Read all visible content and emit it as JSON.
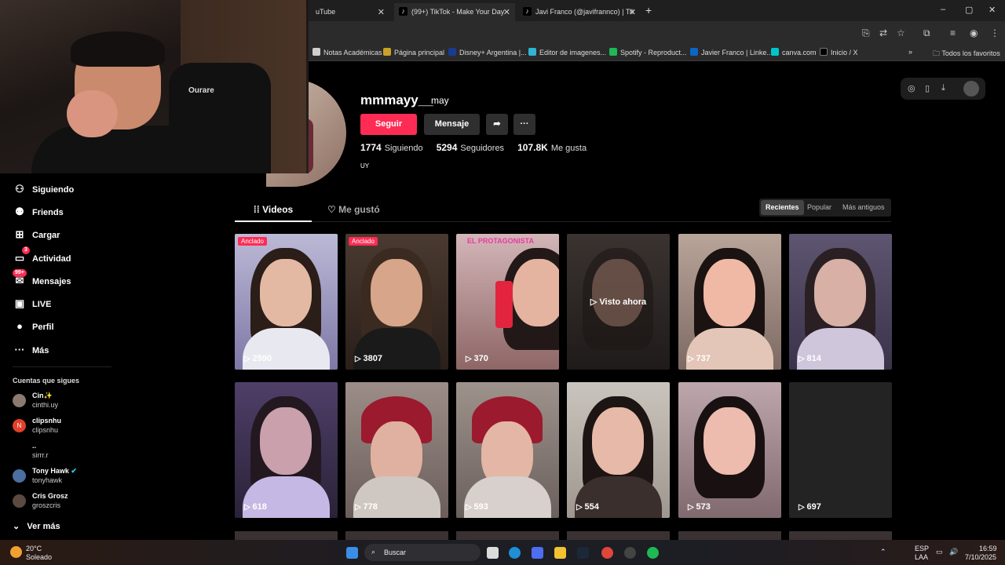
{
  "browser": {
    "tabs": [
      {
        "label": "uTube",
        "icon": "youtube-icon"
      },
      {
        "label": "(99+) TikTok - Make Your Day",
        "icon": "tiktok-icon"
      },
      {
        "label": "Javi Franco (@javifrannco) | Tik",
        "icon": "tiktok-icon"
      }
    ],
    "new_tab": "+",
    "window_controls": [
      "–",
      "▢",
      "✕"
    ],
    "bookmarks": [
      {
        "label": "Notas Académicas",
        "color": "#cfcfcf"
      },
      {
        "label": "Página principal",
        "color": "#c9a227"
      },
      {
        "label": "Disney+ Argentina |...",
        "color": "#1a3c8e"
      },
      {
        "label": "Editor de imagenes...",
        "color": "#31b3d4"
      },
      {
        "label": "Spotify - Reproduct...",
        "color": "#1db954"
      },
      {
        "label": "Javier Franco | Linke...",
        "color": "#0a66c2"
      },
      {
        "label": "canva.com",
        "color": "#00c4cc"
      },
      {
        "label": "Inicio / X",
        "color": "#000000"
      }
    ],
    "bookmarks_overflow": "»",
    "all_bookmarks": "Todos los favoritos"
  },
  "webcam": {
    "chair_label": "Ourare"
  },
  "profile": {
    "username": "mmmayy__",
    "nickname": "may",
    "follow_button": "Seguir",
    "message_button": "Mensaje",
    "following_count": "1774",
    "following_label": "Siguiendo",
    "followers_count": "5294",
    "followers_label": "Seguidores",
    "likes_count": "107.8K",
    "likes_label": "Me gusta",
    "bio": "UY"
  },
  "tabs": {
    "videos": "Videos",
    "liked": "Me gustó"
  },
  "sort": {
    "recent": "Recientes",
    "popular": "Popular",
    "oldest": "Más antiguos"
  },
  "sidebar": {
    "items": [
      {
        "label": "Siguiendo",
        "icon": "following-icon"
      },
      {
        "label": "Friends",
        "icon": "friends-icon"
      },
      {
        "label": "Cargar",
        "icon": "upload-icon"
      },
      {
        "label": "Actividad",
        "icon": "activity-icon",
        "badge": "3"
      },
      {
        "label": "Mensajes",
        "icon": "messages-icon",
        "badge": "99+"
      },
      {
        "label": "LIVE",
        "icon": "live-icon"
      },
      {
        "label": "Perfil",
        "icon": "profile-icon"
      },
      {
        "label": "Más",
        "icon": "more-icon"
      }
    ],
    "following_title": "Cuentas que sigues",
    "accounts": [
      {
        "name": "Cin✨",
        "handle": "cinthi.uy",
        "avatar": ""
      },
      {
        "name": "clipsnhu",
        "handle": "clipsnhu",
        "avatar": "N"
      },
      {
        "name": "..",
        "handle": "sirrr.r",
        "avatar": ""
      },
      {
        "name": "Tony Hawk",
        "handle": "tonyhawk",
        "avatar": ""
      },
      {
        "name": "Cris Grosz",
        "handle": "groszcris",
        "avatar": ""
      }
    ],
    "see_more": "Ver más"
  },
  "videos": [
    {
      "views": "2590",
      "pinned": "Anclado"
    },
    {
      "views": "3807",
      "pinned": "Anclado"
    },
    {
      "views": "370",
      "overlay_title": "EL PROTAGONISTA"
    },
    {
      "overlay": "▷ Visto ahora"
    },
    {
      "views": "737"
    },
    {
      "views": "814"
    },
    {
      "views": "618"
    },
    {
      "views": "778"
    },
    {
      "views": "593"
    },
    {
      "views": "554"
    },
    {
      "views": "573"
    },
    {
      "views": "697"
    }
  ],
  "taskbar": {
    "weather_temp": "20°C",
    "weather_text": "Soleado",
    "search_placeholder": "Buscar",
    "lang1": "ESP",
    "lang2": "LAA",
    "time": "16:59",
    "date": "7/10/2025"
  }
}
